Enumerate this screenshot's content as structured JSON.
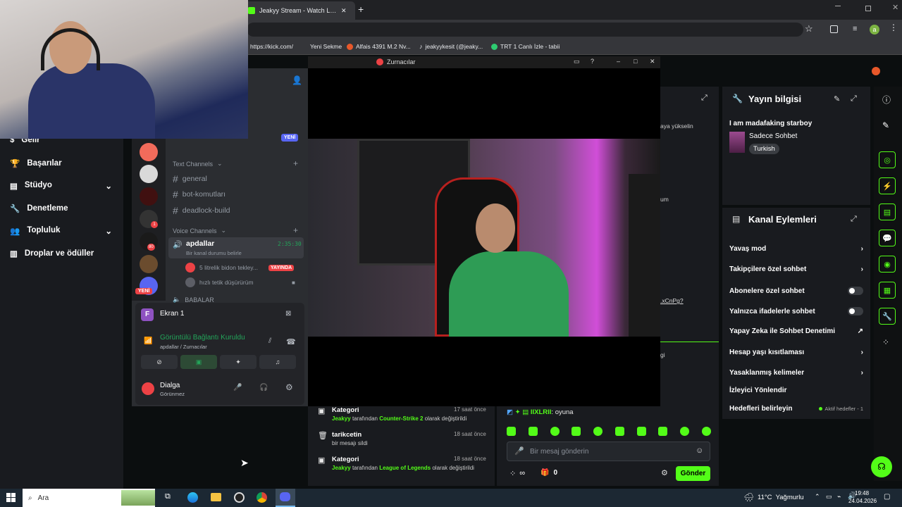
{
  "browser": {
    "tab_title": "Jeakyy Stream - Watch Live on",
    "tab_close": "✕",
    "new_tab": "+",
    "bookmarks": [
      {
        "label": "https://kick.com/"
      },
      {
        "label": "Yeni Sekme"
      },
      {
        "label": "Alfais 4391 M.2 Nv..."
      },
      {
        "label": "jeakyykesit (@jeaky..."
      },
      {
        "label": "TRT 1 Canlı İzle - tabii"
      }
    ],
    "profile_initial": "a"
  },
  "kick_nav": {
    "items": [
      {
        "label": "Gelir"
      },
      {
        "label": "Başarılar"
      },
      {
        "label": "Stüdyo"
      },
      {
        "label": "Denetleme"
      },
      {
        "label": "Topluluk"
      },
      {
        "label": "Droplar ve ödüller"
      }
    ]
  },
  "discord": {
    "new_badge": "YENİ",
    "text_channels_header": "Text Channels",
    "text_channels": [
      "general",
      "bot-komutları",
      "deadlock-build"
    ],
    "voice_channels_header": "Voice Channels",
    "voice_channel": {
      "name": "apdallar",
      "status": "Bir kanal durumu belirle",
      "timer": "2:35:30"
    },
    "voice_members": [
      {
        "name": "5 litrelik bidon tekley...",
        "badge": "YAYINDA"
      },
      {
        "name": "hızlı tetik düşürürüm",
        "badge": ""
      }
    ],
    "next_channel": "BABALAR",
    "guild_badges": {
      "g4": "1",
      "g5": "80"
    },
    "new_guild_badge": "YENİ",
    "screen_share": {
      "initial": "F",
      "label": "Ekran 1"
    },
    "connection": {
      "status": "Görüntülü Bağlantı Kuruldu",
      "path": "apdallar / Zurnacılar"
    },
    "user": {
      "name": "Dialga",
      "status": "Görünmez"
    }
  },
  "popout": {
    "title": "Zurnacılar"
  },
  "activity_log": [
    {
      "title": "Kategori",
      "time": "17 saat önce",
      "user": "Jeakyy",
      "mid": "tarafından",
      "value": "Counter-Strike 2",
      "tail": "olarak değiştirildi"
    },
    {
      "title": "tarikcetin",
      "time": "18 saat önce",
      "desc": "bir mesajı sildi"
    },
    {
      "title": "Kategori",
      "time": "18 saat önce",
      "user": "Jeakyy",
      "mid": "tarafından",
      "value": "League of Legends",
      "tail": "olarak değiştirildi"
    }
  ],
  "chat": {
    "last_user": "IIXLRII",
    "last_message": ": oyuna",
    "placeholder": "Bir mesaj gönderin",
    "points": "∞",
    "gift_count": "0",
    "send_label": "Gönder"
  },
  "partial_text": {
    "yukselin": "aya yükselin",
    "um": "um",
    "xcnpg": ".xCnPg?",
    "gi": "gi"
  },
  "stream_info": {
    "title": "Yayın bilgisi",
    "stream_title": "I am madafaking starboy",
    "category": "Sadece Sohbet",
    "tag": "Turkish"
  },
  "channel_actions": {
    "title": "Kanal Eylemleri",
    "items": [
      {
        "label": "Yavaş mod"
      },
      {
        "label": "Takipçilere özel sohbet"
      },
      {
        "label": "Abonelere özel sohbet"
      },
      {
        "label": "Yalnızca ifadelerle sohbet"
      },
      {
        "label": "Yapay Zeka ile Sohbet Denetimi"
      },
      {
        "label": "Hesap yaşı kısıtlaması"
      },
      {
        "label": "Yasaklanmış kelimeler"
      },
      {
        "label": "İzleyici Yönlendir"
      },
      {
        "label": "Hedefleri belirleyin",
        "extra": "Aktif hedefler - 1"
      }
    ]
  },
  "taskbar": {
    "search": "Ara",
    "weather": "11°C  Yağmurlu",
    "time": "19:48",
    "date": "24.04.2026"
  },
  "colors": {
    "kick_green": "#53fc18",
    "discord_bg": "#2b2d31",
    "live_red": "#ed4245"
  }
}
